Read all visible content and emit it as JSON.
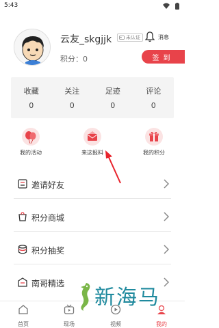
{
  "status_bar": {
    "time": "5:43"
  },
  "profile": {
    "username": "云友_skgjjk",
    "verify_label": "未认证",
    "message_label": "消息",
    "points_text": "积分：0",
    "checkin_label": "签到"
  },
  "stats": [
    {
      "label": "收藏",
      "value": "0"
    },
    {
      "label": "关注",
      "value": "0"
    },
    {
      "label": "足迹",
      "value": "0"
    },
    {
      "label": "评论",
      "value": "0"
    }
  ],
  "quick_actions": [
    {
      "label": "我的活动",
      "icon": "balloon-icon"
    },
    {
      "label": "来这报料",
      "icon": "envelope-icon"
    },
    {
      "label": "我的积分",
      "icon": "gift-icon"
    }
  ],
  "menu": [
    {
      "label": "邀请好友",
      "icon": "invite-icon"
    },
    {
      "label": "积分商城",
      "icon": "store-icon"
    },
    {
      "label": "积分抽奖",
      "icon": "lottery-icon"
    },
    {
      "label": "南哥精选",
      "icon": "selection-icon"
    }
  ],
  "bottom_nav": [
    {
      "label": "首页",
      "icon": "home-icon"
    },
    {
      "label": "现场",
      "icon": "tv-icon"
    },
    {
      "label": "视频",
      "icon": "video-icon"
    },
    {
      "label": "我的",
      "icon": "profile-icon",
      "active": true
    }
  ],
  "watermark": {
    "text": "新海马"
  },
  "colors": {
    "accent": "#e8434a",
    "watermark": "#1f8a9e",
    "stats_bg": "#f4f4f4"
  }
}
